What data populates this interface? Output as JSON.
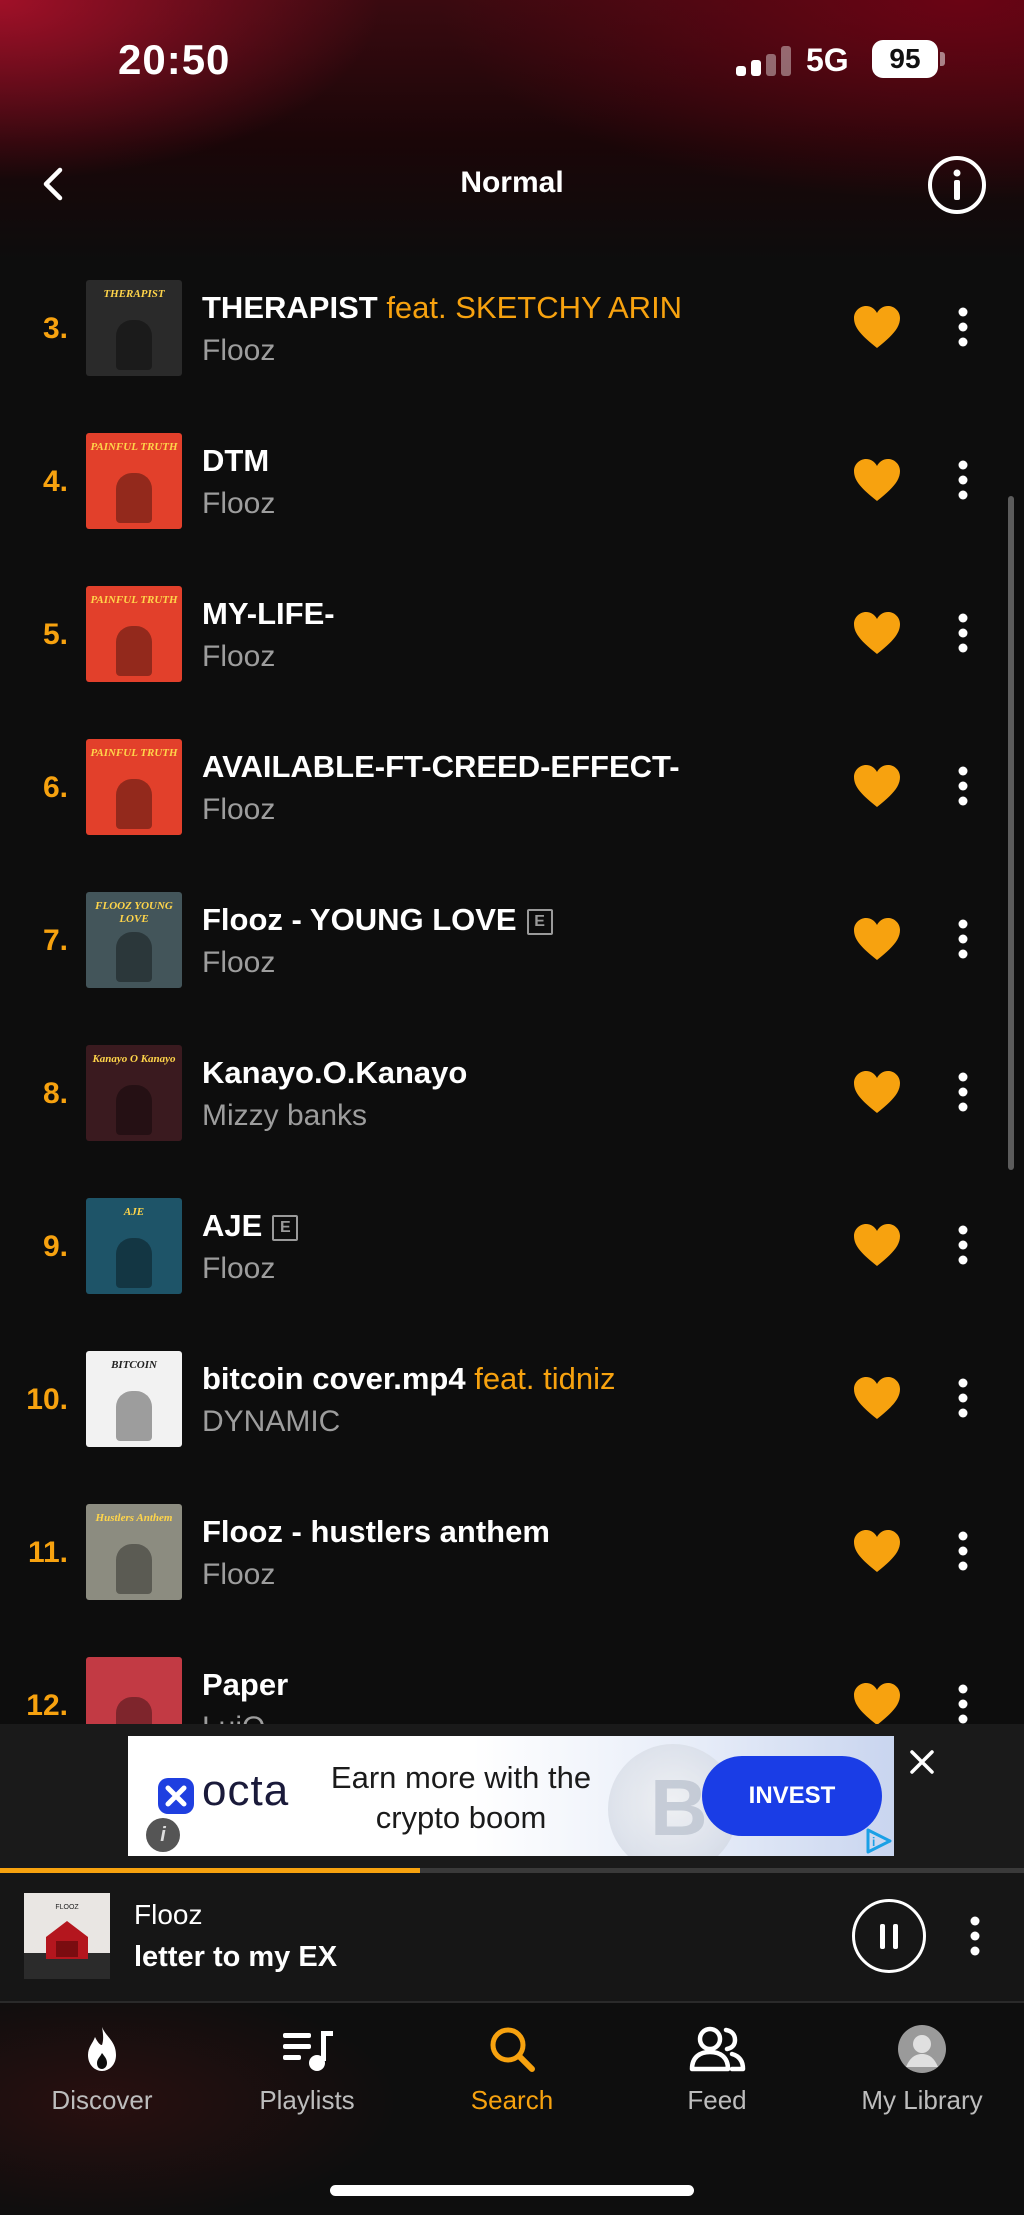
{
  "status_bar": {
    "time": "20:50",
    "network": "5G",
    "battery": "95"
  },
  "header": {
    "title": "Normal"
  },
  "tracks": [
    {
      "number": "3.",
      "title": "THERAPIST",
      "feat": "feat. SKETCHY ARIN",
      "explicit": "",
      "artist": "Flooz",
      "cover_text": "THERAPIST"
    },
    {
      "number": "4.",
      "title": "DTM",
      "feat": "",
      "explicit": "",
      "artist": "Flooz",
      "cover_text": "PAINFUL TRUTH"
    },
    {
      "number": "5.",
      "title": "MY-LIFE-",
      "feat": "",
      "explicit": "",
      "artist": "Flooz",
      "cover_text": "PAINFUL TRUTH"
    },
    {
      "number": "6.",
      "title": "AVAILABLE-FT-CREED-EFFECT-",
      "feat": "",
      "explicit": "",
      "artist": "Flooz",
      "cover_text": "PAINFUL TRUTH"
    },
    {
      "number": "7.",
      "title": "Flooz - YOUNG LOVE",
      "feat": "",
      "explicit": "E",
      "artist": "Flooz",
      "cover_text": "FLOOZ YOUNG LOVE"
    },
    {
      "number": "8.",
      "title": "Kanayo.O.Kanayo",
      "feat": "",
      "explicit": "",
      "artist": "Mizzy banks",
      "cover_text": "Kanayo O Kanayo"
    },
    {
      "number": "9.",
      "title": "AJE",
      "feat": "",
      "explicit": "E",
      "artist": "Flooz",
      "cover_text": "AJE"
    },
    {
      "number": "10.",
      "title": "bitcoin cover.mp4",
      "feat": "feat. tidniz",
      "explicit": "",
      "artist": "DYNAMIC",
      "cover_text": "BITCOIN"
    },
    {
      "number": "11.",
      "title": "Flooz -  hustlers anthem",
      "feat": "",
      "explicit": "",
      "artist": "Flooz",
      "cover_text": "Hustlers Anthem"
    },
    {
      "number": "12.",
      "title": "Paper",
      "feat": "",
      "explicit": "",
      "artist": "LuiO",
      "cover_text": ""
    }
  ],
  "ad": {
    "brand": "octa",
    "headline": "Earn more with the crypto boom",
    "cta": "INVEST",
    "info": "i",
    "coin_symbol": "B"
  },
  "now_playing": {
    "artist": "Flooz",
    "title": "letter to my EX",
    "progress": 0.41
  },
  "tabs": [
    {
      "label": "Discover",
      "icon": "flame-icon"
    },
    {
      "label": "Playlists",
      "icon": "playlist-icon"
    },
    {
      "label": "Search",
      "icon": "search-icon",
      "active": true
    },
    {
      "label": "Feed",
      "icon": "people-icon"
    },
    {
      "label": "My Library",
      "icon": "avatar"
    }
  ],
  "colors": {
    "accent": "#f7a20f",
    "background": "#0d0d0d",
    "ad_cta": "#1a3de6"
  }
}
